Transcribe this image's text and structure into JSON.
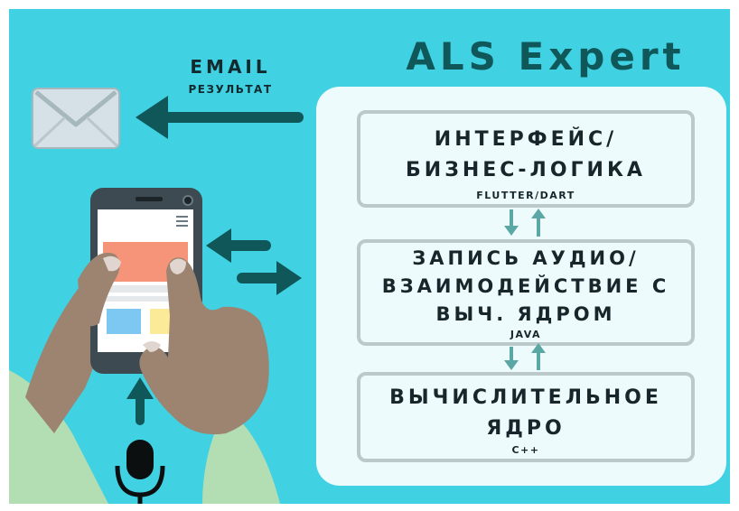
{
  "title": "ALS Expert",
  "email": {
    "label": "EMAIL",
    "sublabel": "РЕЗУЛЬТАТ"
  },
  "layers": [
    {
      "line1": "ИНТЕРФЕЙС/",
      "line2": "БИЗНЕС-ЛОГИКА",
      "line3": "",
      "tech": "FLUTTER/DART"
    },
    {
      "line1": "ЗАПИСЬ АУДИО/",
      "line2": "ВЗАИМОДЕЙСТВИЕ С",
      "line3": "ВЫЧ. ЯДРОМ",
      "tech": "JAVA"
    },
    {
      "line1": "ВЫЧИСЛИТЕЛЬНОЕ",
      "line2": "ЯДРО",
      "line3": "",
      "tech": "C++"
    }
  ],
  "icons": [
    "envelope-icon",
    "phone-icon",
    "hands-illustration",
    "microphone-icon",
    "arrow-left-icon",
    "arrow-right-icon",
    "arrow-up-icon"
  ],
  "colors": {
    "background": "#40D1E3",
    "panel": "#EEFBFC",
    "dark_teal": "#0F5759",
    "arrow_teal": "#5BA7A6",
    "box_border": "#BCC9CB"
  }
}
